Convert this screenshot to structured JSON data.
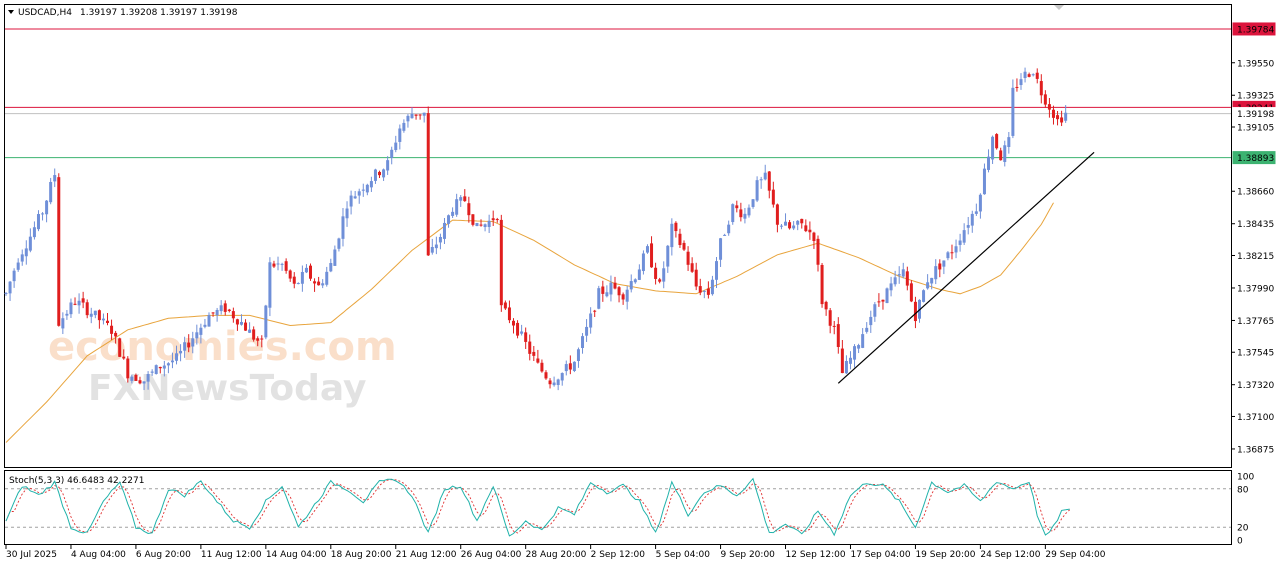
{
  "header": {
    "symbol": "USDCAD,H4",
    "ohlc": "1.39197 1.39208 1.39197 1.39198"
  },
  "stoch": {
    "label": "Stoch(5,3,3) 46.6483 42.2271",
    "levels": [
      {
        "value": 80,
        "label": "80"
      },
      {
        "value": 20,
        "label": "20"
      }
    ],
    "scale_labels": [
      "100",
      "80",
      "20",
      "0"
    ],
    "main_color": "#20b2aa",
    "signal_color": "#e03030"
  },
  "watermark": {
    "line1": "economies.com",
    "line2": "FXNewsToday"
  },
  "colors": {
    "bull": "#6f8fd8",
    "bear": "#e01e1e",
    "ma": "#e8a43c",
    "resistance": "#dc143c",
    "support": "#3cb371",
    "current": "#c0c0c0",
    "trendline": "#000000"
  },
  "chart_data": {
    "type": "candlestick",
    "ylim": [
      1.3675,
      1.3995
    ],
    "y_ticks": [
      "1.39550",
      "1.39325",
      "1.39105",
      "1.38660",
      "1.38435",
      "1.38215",
      "1.37990",
      "1.37765",
      "1.37545",
      "1.37320",
      "1.37100",
      "1.36875"
    ],
    "x_ticks": [
      "30 Jul 2025",
      "4 Aug 04:00",
      "6 Aug 20:00",
      "11 Aug 12:00",
      "14 Aug 04:00",
      "18 Aug 20:00",
      "21 Aug 12:00",
      "26 Aug 04:00",
      "28 Aug 20:00",
      "2 Sep 12:00",
      "5 Sep 04:00",
      "9 Sep 20:00",
      "12 Sep 12:00",
      "17 Sep 04:00",
      "19 Sep 20:00",
      "24 Sep 12:00",
      "29 Sep 04:00"
    ],
    "x_tick_index": [
      0,
      16,
      32,
      48,
      64,
      80,
      96,
      112,
      128,
      144,
      160,
      176,
      192,
      208,
      224,
      240,
      256
    ],
    "levels": [
      {
        "value": 1.39784,
        "label": "1.39784",
        "kind": "resistance"
      },
      {
        "value": 1.39241,
        "label": "1.39241",
        "kind": "resistance"
      },
      {
        "value": 1.39198,
        "label": "1.39198",
        "kind": "current"
      },
      {
        "value": 1.38893,
        "label": "1.38893",
        "kind": "support"
      }
    ],
    "trendline": {
      "from": [
        205,
        1.3733
      ],
      "to": [
        268,
        1.3893
      ]
    },
    "path": [
      [
        0,
        1.3795
      ],
      [
        3,
        1.382
      ],
      [
        6,
        1.3835
      ],
      [
        9,
        1.3852
      ],
      [
        12,
        1.3878
      ],
      [
        13,
        1.3775
      ],
      [
        17,
        1.379
      ],
      [
        21,
        1.3782
      ],
      [
        26,
        1.377
      ],
      [
        30,
        1.374
      ],
      [
        34,
        1.3735
      ],
      [
        38,
        1.3745
      ],
      [
        42,
        1.375
      ],
      [
        46,
        1.3765
      ],
      [
        50,
        1.378
      ],
      [
        54,
        1.3785
      ],
      [
        58,
        1.3775
      ],
      [
        61,
        1.3765
      ],
      [
        63,
        1.376
      ],
      [
        65,
        1.3815
      ],
      [
        68,
        1.3815
      ],
      [
        71,
        1.38
      ],
      [
        74,
        1.381
      ],
      [
        77,
        1.38
      ],
      [
        80,
        1.3815
      ],
      [
        84,
        1.3858
      ],
      [
        88,
        1.387
      ],
      [
        92,
        1.388
      ],
      [
        94,
        1.3885
      ],
      [
        97,
        1.391
      ],
      [
        100,
        1.392
      ],
      [
        103,
        1.392
      ],
      [
        104,
        1.382
      ],
      [
        107,
        1.3835
      ],
      [
        110,
        1.3855
      ],
      [
        113,
        1.386
      ],
      [
        116,
        1.384
      ],
      [
        119,
        1.3845
      ],
      [
        121,
        1.385
      ],
      [
        122,
        1.3785
      ],
      [
        125,
        1.3775
      ],
      [
        128,
        1.376
      ],
      [
        131,
        1.3745
      ],
      [
        134,
        1.3735
      ],
      [
        137,
        1.374
      ],
      [
        140,
        1.3748
      ],
      [
        143,
        1.377
      ],
      [
        146,
        1.3795
      ],
      [
        149,
        1.38
      ],
      [
        152,
        1.3795
      ],
      [
        155,
        1.3808
      ],
      [
        158,
        1.3825
      ],
      [
        161,
        1.38
      ],
      [
        164,
        1.384
      ],
      [
        167,
        1.3825
      ],
      [
        170,
        1.38
      ],
      [
        173,
        1.3795
      ],
      [
        176,
        1.383
      ],
      [
        179,
        1.3855
      ],
      [
        182,
        1.385
      ],
      [
        185,
        1.387
      ],
      [
        187,
        1.3875
      ],
      [
        190,
        1.3845
      ],
      [
        193,
        1.384
      ],
      [
        196,
        1.3843
      ],
      [
        199,
        1.3835
      ],
      [
        201,
        1.379
      ],
      [
        204,
        1.377
      ],
      [
        206,
        1.374
      ],
      [
        209,
        1.3755
      ],
      [
        212,
        1.3775
      ],
      [
        215,
        1.379
      ],
      [
        218,
        1.38
      ],
      [
        221,
        1.381
      ],
      [
        224,
        1.378
      ],
      [
        227,
        1.3805
      ],
      [
        230,
        1.3815
      ],
      [
        233,
        1.3825
      ],
      [
        236,
        1.384
      ],
      [
        239,
        1.3855
      ],
      [
        241,
        1.388
      ],
      [
        243,
        1.3905
      ],
      [
        245,
        1.389
      ],
      [
        247,
        1.39
      ],
      [
        248,
        1.3935
      ],
      [
        250,
        1.3945
      ],
      [
        253,
        1.395
      ],
      [
        255,
        1.3935
      ],
      [
        257,
        1.3925
      ],
      [
        259,
        1.3915
      ],
      [
        261,
        1.392
      ]
    ],
    "ma_path": [
      [
        0,
        1.3692
      ],
      [
        10,
        1.372
      ],
      [
        20,
        1.3752
      ],
      [
        30,
        1.377
      ],
      [
        40,
        1.3778
      ],
      [
        50,
        1.378
      ],
      [
        60,
        1.378
      ],
      [
        70,
        1.3773
      ],
      [
        80,
        1.3775
      ],
      [
        90,
        1.3798
      ],
      [
        100,
        1.3825
      ],
      [
        110,
        1.3846
      ],
      [
        120,
        1.3845
      ],
      [
        130,
        1.3832
      ],
      [
        140,
        1.3815
      ],
      [
        150,
        1.3802
      ],
      [
        160,
        1.3797
      ],
      [
        170,
        1.3795
      ],
      [
        180,
        1.3807
      ],
      [
        190,
        1.3822
      ],
      [
        200,
        1.383
      ],
      [
        210,
        1.382
      ],
      [
        220,
        1.3807
      ],
      [
        230,
        1.3798
      ],
      [
        235,
        1.3795
      ],
      [
        240,
        1.38
      ],
      [
        245,
        1.3808
      ],
      [
        250,
        1.3825
      ],
      [
        255,
        1.3843
      ],
      [
        258,
        1.3858
      ]
    ],
    "stoch_path": [
      [
        0,
        30
      ],
      [
        4,
        85
      ],
      [
        8,
        70
      ],
      [
        12,
        90
      ],
      [
        16,
        20
      ],
      [
        20,
        10
      ],
      [
        24,
        60
      ],
      [
        28,
        90
      ],
      [
        32,
        20
      ],
      [
        36,
        10
      ],
      [
        40,
        80
      ],
      [
        44,
        70
      ],
      [
        48,
        92
      ],
      [
        52,
        60
      ],
      [
        56,
        30
      ],
      [
        60,
        20
      ],
      [
        64,
        60
      ],
      [
        68,
        85
      ],
      [
        72,
        20
      ],
      [
        76,
        55
      ],
      [
        80,
        90
      ],
      [
        84,
        80
      ],
      [
        88,
        60
      ],
      [
        92,
        90
      ],
      [
        96,
        95
      ],
      [
        100,
        70
      ],
      [
        104,
        10
      ],
      [
        108,
        80
      ],
      [
        112,
        85
      ],
      [
        116,
        30
      ],
      [
        120,
        85
      ],
      [
        124,
        5
      ],
      [
        128,
        30
      ],
      [
        132,
        15
      ],
      [
        136,
        50
      ],
      [
        140,
        40
      ],
      [
        144,
        90
      ],
      [
        148,
        75
      ],
      [
        152,
        85
      ],
      [
        156,
        60
      ],
      [
        160,
        10
      ],
      [
        164,
        90
      ],
      [
        168,
        40
      ],
      [
        172,
        75
      ],
      [
        176,
        85
      ],
      [
        180,
        70
      ],
      [
        184,
        95
      ],
      [
        188,
        10
      ],
      [
        192,
        25
      ],
      [
        196,
        8
      ],
      [
        200,
        45
      ],
      [
        204,
        10
      ],
      [
        208,
        70
      ],
      [
        212,
        90
      ],
      [
        216,
        85
      ],
      [
        220,
        60
      ],
      [
        224,
        20
      ],
      [
        228,
        90
      ],
      [
        232,
        75
      ],
      [
        236,
        85
      ],
      [
        240,
        60
      ],
      [
        244,
        92
      ],
      [
        248,
        80
      ],
      [
        252,
        92
      ],
      [
        254,
        40
      ],
      [
        256,
        5
      ],
      [
        258,
        20
      ],
      [
        260,
        45
      ],
      [
        262,
        46
      ]
    ]
  }
}
